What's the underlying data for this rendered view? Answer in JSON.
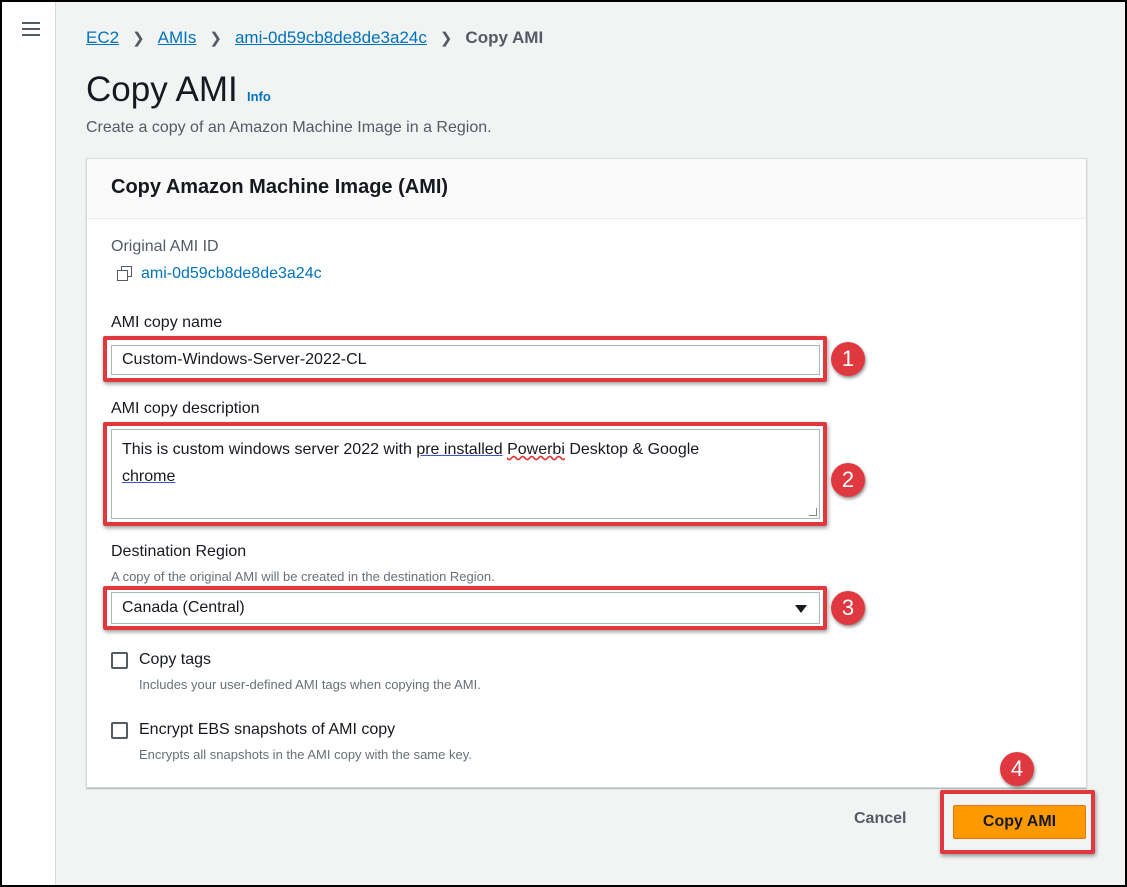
{
  "breadcrumb": {
    "items": [
      "EC2",
      "AMIs",
      "ami-0d59cb8de8de3a24c"
    ],
    "current": "Copy AMI"
  },
  "page": {
    "title": "Copy AMI",
    "info_link": "Info",
    "subtitle": "Create a copy of an Amazon Machine Image in a Region."
  },
  "panel": {
    "heading": "Copy Amazon Machine Image (AMI)",
    "original_ami_label": "Original AMI ID",
    "original_ami_id": "ami-0d59cb8de8de3a24c",
    "copy_name_label": "AMI copy name",
    "copy_name_value": "Custom-Windows-Server-2022-CL",
    "description_label": "AMI copy description",
    "description_parts": {
      "p1": "This is custom windows server 2022 with ",
      "p2": "pre installed",
      "p3": " ",
      "p4": "Powerbi",
      "p5": " Desktop & Google",
      "p6": "chrome"
    },
    "region_label": "Destination Region",
    "region_hint": "A copy of the original AMI will be created in the destination Region.",
    "region_value": "Canada (Central)",
    "copy_tags_label": "Copy tags",
    "copy_tags_hint": "Includes your user-defined AMI tags when copying the AMI.",
    "encrypt_label": "Encrypt EBS snapshots of AMI copy",
    "encrypt_hint": "Encrypts all snapshots in the AMI copy with the same key."
  },
  "actions": {
    "cancel": "Cancel",
    "submit": "Copy AMI"
  },
  "annotations": [
    "1",
    "2",
    "3",
    "4"
  ],
  "colors": {
    "link": "#0073bb",
    "primary": "#ff9900",
    "highlight": "#e0383f"
  },
  "icons": [
    "menu-icon",
    "chevron-right-icon",
    "copy-icon",
    "caret-down-icon"
  ]
}
